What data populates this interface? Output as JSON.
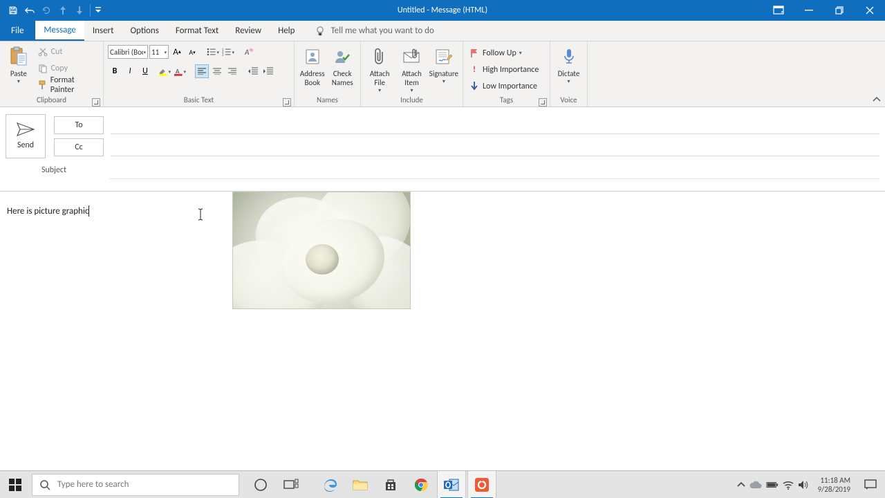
{
  "title_bar": {
    "title": "Untitled  -  Message (HTML)"
  },
  "tabs": {
    "file": "File",
    "message": "Message",
    "insert": "Insert",
    "options": "Options",
    "format_text": "Format Text",
    "review": "Review",
    "help": "Help",
    "tell_me": "Tell me what you want to do"
  },
  "ribbon": {
    "clipboard": {
      "label": "Clipboard",
      "paste": "Paste",
      "cut": "Cut",
      "copy": "Copy",
      "format_painter": "Format Painter"
    },
    "basic_text": {
      "label": "Basic Text",
      "font_name": "Calibri (Boc",
      "font_size": "11"
    },
    "names": {
      "label": "Names",
      "address_book": "Address\nBook",
      "check_names": "Check\nNames"
    },
    "include": {
      "label": "Include",
      "attach_file": "Attach\nFile",
      "attach_item": "Attach\nItem",
      "signature": "Signature"
    },
    "tags": {
      "label": "Tags",
      "follow_up": "Follow Up",
      "high": "High Importance",
      "low": "Low Importance"
    },
    "voice": {
      "label": "Voice",
      "dictate": "Dictate"
    }
  },
  "header": {
    "send": "Send",
    "to_label": "To",
    "cc_label": "Cc",
    "subject_label": "Subject",
    "to_value": "",
    "cc_value": "",
    "subject_value": ""
  },
  "body": {
    "text": "Here is picture graphic "
  },
  "taskbar": {
    "search_placeholder": "Type here to search",
    "clock_time": "11:18 AM",
    "clock_date": "9/28/2019"
  }
}
